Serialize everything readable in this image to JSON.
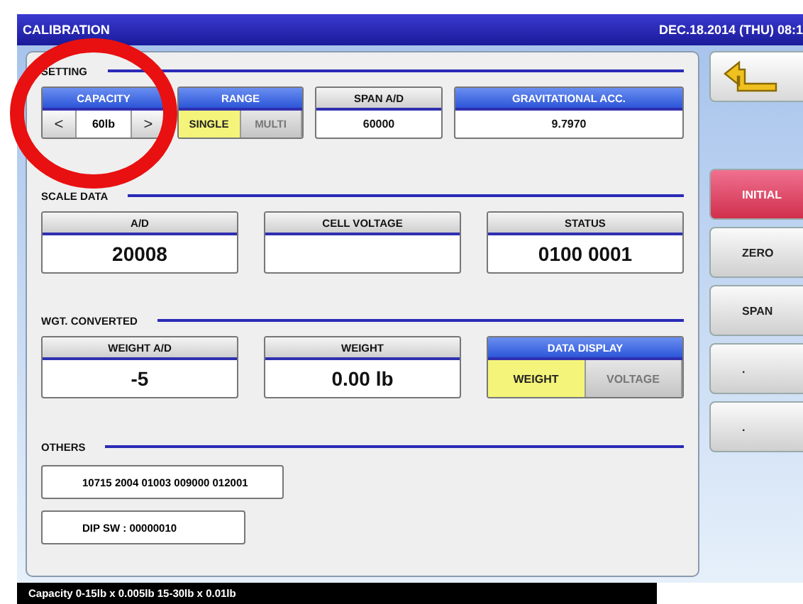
{
  "window": {
    "title": "CALIBRATION",
    "datetime": "DEC.18.2014 (THU) 08:1"
  },
  "sections": [
    {
      "title": "SETTING",
      "fields": [
        {
          "kind": "stepper",
          "label": "CAPACITY",
          "editable": true,
          "value": "60lb",
          "prev": "<",
          "next": ">"
        },
        {
          "kind": "toggle",
          "label": "RANGE",
          "editable": true,
          "options": [
            {
              "label": "SINGLE",
              "selected": true
            },
            {
              "label": "MULTI",
              "selected": false
            }
          ]
        },
        {
          "kind": "display",
          "label": "SPAN A/D",
          "editable": false,
          "value": "60000"
        },
        {
          "kind": "display",
          "label": "GRAVITATIONAL ACC.",
          "editable": true,
          "value": "9.7970"
        }
      ]
    },
    {
      "title": "SCALE DATA",
      "fields": [
        {
          "kind": "display",
          "label": "A/D",
          "editable": false,
          "value": "20008"
        },
        {
          "kind": "display",
          "label": "CELL VOLTAGE",
          "editable": false
        },
        {
          "kind": "display",
          "label": "STATUS",
          "editable": false,
          "value": "0100 0001"
        }
      ]
    },
    {
      "title": "WGT. CONVERTED",
      "fields": [
        {
          "kind": "display",
          "label": "WEIGHT A/D",
          "editable": false,
          "value": "-5"
        },
        {
          "kind": "display",
          "label": "WEIGHT",
          "editable": false,
          "value": "0.00 lb"
        },
        {
          "kind": "toggle",
          "label": "DATA DISPLAY",
          "editable": true,
          "options": [
            {
              "label": "WEIGHT",
              "selected": true
            },
            {
              "label": "VOLTAGE",
              "selected": false
            }
          ]
        }
      ]
    },
    {
      "title": "OTHERS",
      "lines": [
        "10715 2004 01003 009000 012001",
        "DIP SW : 00000010"
      ]
    }
  ],
  "side_buttons": [
    {
      "kind": "back"
    },
    {
      "kind": "alert",
      "label": "INITIAL"
    },
    {
      "kind": "normal",
      "label": "ZERO"
    },
    {
      "kind": "normal",
      "label": "SPAN"
    },
    {
      "kind": "normal",
      "label": "."
    },
    {
      "kind": "normal",
      "label": "."
    }
  ],
  "status_bar": "Capacity 0-15lb x 0.005lb  15-30lb x 0.01lb"
}
